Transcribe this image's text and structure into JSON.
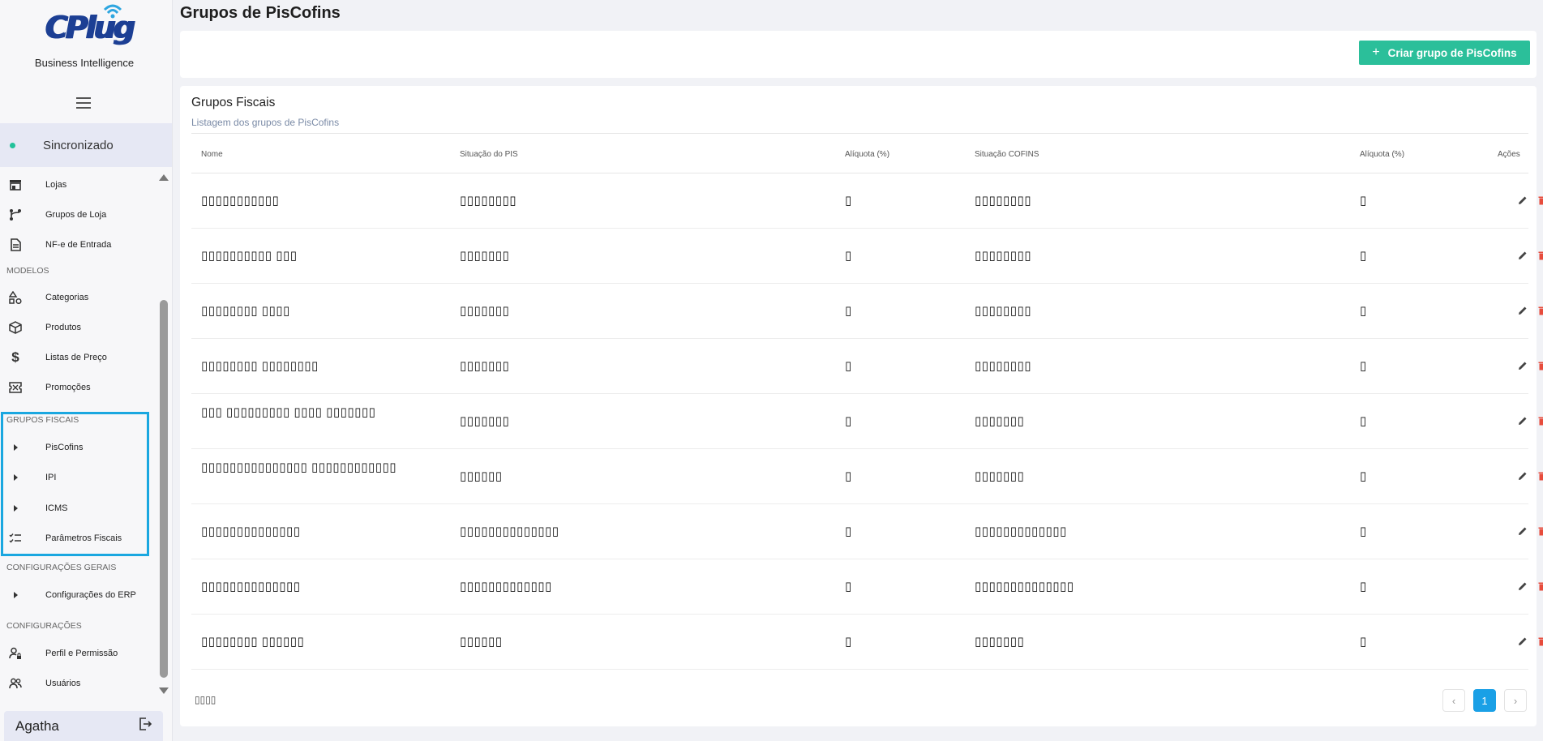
{
  "app": {
    "brand": "CPlug",
    "subtitle": "Business Intelligence",
    "sync_label": "Sincronizado"
  },
  "sidebar": {
    "items_top": [
      {
        "label": "Lojas",
        "icon": "store-icon"
      },
      {
        "label": "Grupos de Loja",
        "icon": "branch-icon"
      },
      {
        "label": "NF-e de Entrada",
        "icon": "document-icon"
      }
    ],
    "section_modelos": "MODELOS",
    "items_modelos": [
      {
        "label": "Categorias",
        "icon": "shapes-icon"
      },
      {
        "label": "Produtos",
        "icon": "box-icon"
      },
      {
        "label": "Listas de Preço",
        "icon": "dollar-icon"
      },
      {
        "label": "Promoções",
        "icon": "ticket-icon"
      }
    ],
    "section_fiscais": "GRUPOS FISCAIS",
    "items_fiscais": [
      {
        "label": "PisCofins",
        "icon": "caret-right-icon"
      },
      {
        "label": "IPI",
        "icon": "caret-right-icon"
      },
      {
        "label": "ICMS",
        "icon": "caret-right-icon"
      },
      {
        "label": "Parâmetros Fiscais",
        "icon": "checklist-icon"
      }
    ],
    "section_config_gerais": "CONFIGURAÇÕES GERAIS",
    "items_config_gerais": [
      {
        "label": "Configurações do ERP",
        "icon": "caret-right-icon"
      }
    ],
    "section_config": "CONFIGURAÇÕES",
    "items_config": [
      {
        "label": "Perfil e Permissão",
        "icon": "user-lock-icon"
      },
      {
        "label": "Usuários",
        "icon": "users-icon"
      }
    ],
    "user_name": "Agatha"
  },
  "page": {
    "title": "Grupos de PisCofins",
    "create_button": "Criar grupo de PisCofins",
    "create_plus": "+",
    "card_title": "Grupos Fiscais",
    "card_subtitle": "Listagem dos grupos de PisCofins"
  },
  "table": {
    "headers": [
      "Nome",
      "Situação do PIS",
      "Alíquota (%)",
      "Situação COFINS",
      "Alíquota (%)",
      "Ações"
    ],
    "rows": [
      [
        "▯▯▯▯▯▯▯▯▯▯▯",
        "▯▯▯▯▯▯▯▯",
        "▯",
        "▯▯▯▯▯▯▯▯",
        "▯"
      ],
      [
        "▯▯▯▯▯▯▯▯▯▯ ▯▯▯",
        "▯▯▯▯▯▯▯",
        "▯",
        "▯▯▯▯▯▯▯▯",
        "▯"
      ],
      [
        "▯▯▯▯▯▯▯▯ ▯▯▯▯",
        "▯▯▯▯▯▯▯",
        "▯",
        "▯▯▯▯▯▯▯▯",
        "▯"
      ],
      [
        "▯▯▯▯▯▯▯▯ ▯▯▯▯▯▯▯▯",
        "▯▯▯▯▯▯▯",
        "▯",
        "▯▯▯▯▯▯▯▯",
        "▯"
      ],
      [
        "▯▯▯ ▯▯▯▯▯▯▯▯▯ ▯▯▯▯ ▯▯▯▯▯▯▯",
        "▯▯▯▯▯▯▯",
        "▯",
        "▯▯▯▯▯▯▯",
        "▯"
      ],
      [
        "▯▯▯▯▯▯▯▯▯▯▯▯▯▯▯ ▯▯▯▯▯▯▯▯▯▯▯▯",
        "▯▯▯▯▯▯",
        "▯",
        "▯▯▯▯▯▯▯",
        "▯"
      ],
      [
        "▯▯▯▯▯▯▯▯▯▯▯▯▯▯",
        "▯▯▯▯▯▯▯▯▯▯▯▯▯▯",
        "▯",
        "▯▯▯▯▯▯▯▯▯▯▯▯▯",
        "▯"
      ],
      [
        "▯▯▯▯▯▯▯▯▯▯▯▯▯▯",
        "▯▯▯▯▯▯▯▯▯▯▯▯▯",
        "▯",
        "▯▯▯▯▯▯▯▯▯▯▯▯▯▯",
        "▯"
      ],
      [
        "▯▯▯▯▯▯▯▯ ▯▯▯▯▯▯",
        "▯▯▯▯▯▯",
        "▯",
        "▯▯▯▯▯▯▯",
        "▯"
      ]
    ]
  },
  "footer": {
    "total": "▯▯▯▯",
    "prev": "‹",
    "current_page": "1",
    "next": "›"
  },
  "colors": {
    "accent": "#2bbf9a",
    "brand": "#1c3f94",
    "highlight_border": "#1aa7e0",
    "pager_active": "#1aa0e6",
    "delete": "#e74c3c"
  }
}
